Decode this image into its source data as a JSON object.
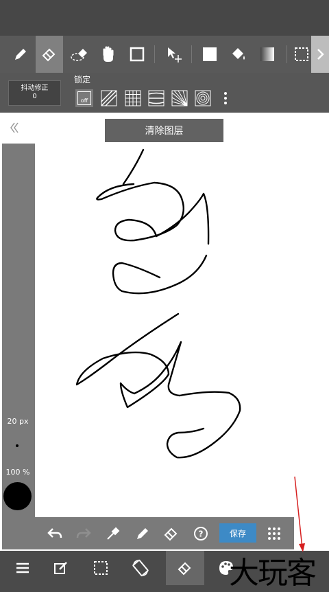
{
  "top_toolbar": {
    "tools": [
      "pen-icon",
      "eraser-icon",
      "lasso-eraser-icon",
      "hand-icon",
      "rectangle-icon",
      "move-icon",
      "fill-color-icon",
      "bucket-icon",
      "gradient-icon",
      "selection-icon"
    ],
    "active_tool": "eraser-icon"
  },
  "sub_toolbar": {
    "stabilization_label": "抖动修正",
    "stabilization_value": "0",
    "lock_label": "锁定",
    "lock_off_label": "off"
  },
  "canvas": {
    "clear_layer_label": "清除图层"
  },
  "brush_panel": {
    "size_label": "20 px",
    "opacity_label": "100 %",
    "color": "#000000"
  },
  "action_bar": {
    "save_label": "保存"
  },
  "watermark": {
    "text": "大玩客"
  },
  "colors": {
    "save_button": "#3d8ac6",
    "arrow": "#d62020"
  }
}
